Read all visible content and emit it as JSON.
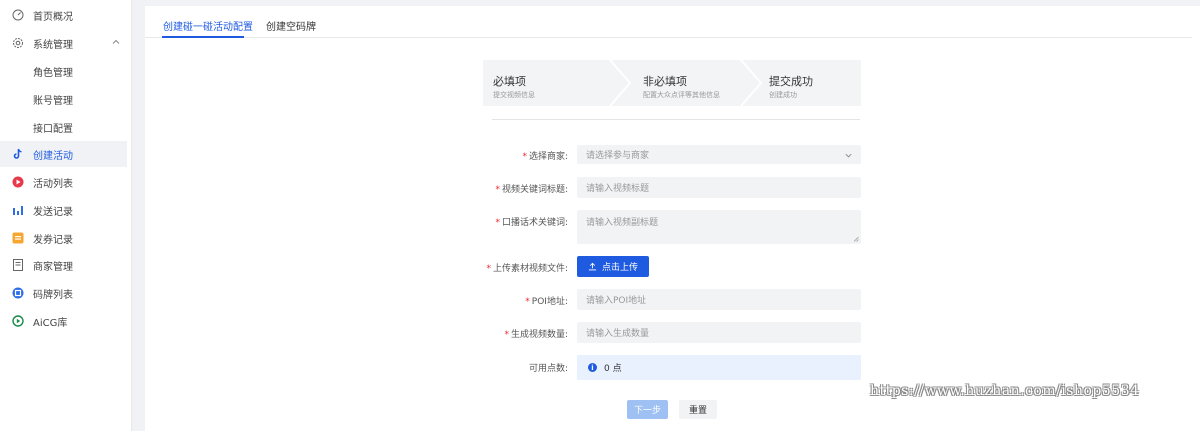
{
  "sidebar": {
    "items": [
      {
        "label": "首页概况",
        "icon": "dashboard-icon"
      },
      {
        "label": "系统管理",
        "icon": "settings-icon"
      },
      {
        "label": "角色管理"
      },
      {
        "label": "账号管理"
      },
      {
        "label": "接口配置"
      },
      {
        "label": "创建活动",
        "icon": "tiktok-icon"
      },
      {
        "label": "活动列表",
        "icon": "activity-list-icon"
      },
      {
        "label": "发送记录",
        "icon": "bar-chart-icon"
      },
      {
        "label": "发券记录",
        "icon": "coupon-icon"
      },
      {
        "label": "商家管理",
        "icon": "merchant-icon"
      },
      {
        "label": "码牌列表",
        "icon": "qr-code-icon"
      },
      {
        "label": "AiCG库",
        "icon": "aicg-icon"
      }
    ]
  },
  "tabs": [
    {
      "label": "创建碰一碰活动配置"
    },
    {
      "label": "创建空码牌"
    }
  ],
  "steps": [
    {
      "title": "必填项",
      "desc": "提交视频信息"
    },
    {
      "title": "非必填项",
      "desc": "配置大众点评等其他信息"
    },
    {
      "title": "提交成功",
      "desc": "创建成功"
    }
  ],
  "form": {
    "merchant": {
      "label": "选择商家:",
      "placeholder": "请选择参与商家"
    },
    "video_title": {
      "label": "视频关键词标题:",
      "placeholder": "请输入视频标题"
    },
    "keywords": {
      "label": "口播话术关键词:",
      "placeholder": "请输入视频副标题"
    },
    "upload": {
      "label": "上传素材视频文件:",
      "button": "点击上传"
    },
    "poi": {
      "label": "POI地址:",
      "placeholder": "请输入POI地址"
    },
    "count": {
      "label": "生成视频数量:",
      "placeholder": "请输入生成数量"
    },
    "points": {
      "label": "可用点数:",
      "value": "0 点"
    },
    "required_mark": "*"
  },
  "actions": {
    "next": "下一步",
    "reset": "重置"
  },
  "watermark": "https://www.huzhan.com/ishop5534",
  "colors": {
    "accent": "#1f5be0",
    "required": "#f5222d"
  }
}
